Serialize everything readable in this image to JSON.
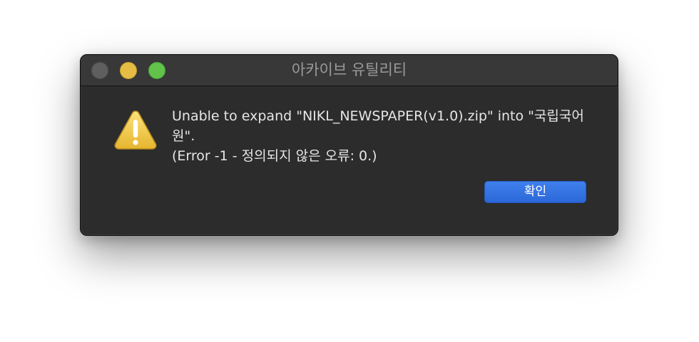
{
  "window": {
    "title": "아카이브 유틸리티"
  },
  "alert": {
    "icon": "warning-triangle-icon",
    "message": "Unable to expand \"NIKL_NEWSPAPER(v1.0).zip\" into \"국립국어원\".",
    "detail": "(Error -1 - 정의되지 않은 오류: 0.)",
    "ok_label": "확인"
  },
  "colors": {
    "window_background": "#2c2c2c",
    "titlebar": "#383838",
    "button_accent": "#2f6fe0",
    "close_light": "#5f5f5f",
    "minimize_light": "#e5bd45",
    "zoom_light": "#62c24b",
    "warning_yellow": "#f0c43a"
  }
}
